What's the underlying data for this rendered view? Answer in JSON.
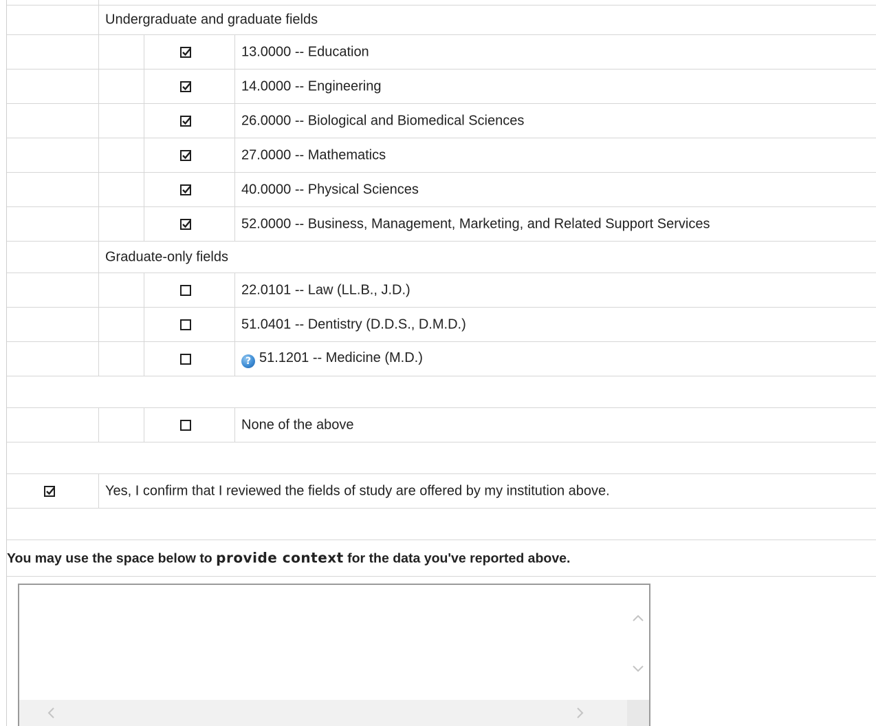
{
  "groups": {
    "undergrad_label": "Undergraduate and graduate fields",
    "grad_label": "Graduate-only fields"
  },
  "fields": [
    {
      "label": "13.0000 -- Education",
      "checked": true
    },
    {
      "label": "14.0000 -- Engineering",
      "checked": true
    },
    {
      "label": "26.0000 -- Biological and Biomedical Sciences",
      "checked": true
    },
    {
      "label": "27.0000 -- Mathematics",
      "checked": true
    },
    {
      "label": "40.0000 -- Physical Sciences",
      "checked": true
    },
    {
      "label": "52.0000 -- Business, Management, Marketing, and Related Support Services",
      "checked": true
    },
    {
      "label": "22.0101 -- Law (LL.B., J.D.)",
      "checked": false
    },
    {
      "label": "51.0401 -- Dentistry (D.D.S., D.M.D.)",
      "checked": false
    },
    {
      "label": "51.1201 -- Medicine (M.D.)",
      "checked": false,
      "help_icon": "help-icon"
    }
  ],
  "none_option": {
    "label": "None of the above",
    "checked": false
  },
  "confirm": {
    "label": "Yes, I confirm that I reviewed the fields of study are offered by my institution above.",
    "checked": true
  },
  "context": {
    "prefix": "You may use the space below to ",
    "emphasis": "provide context",
    "suffix": " for the data you've reported above."
  },
  "textarea": {
    "value": ""
  }
}
